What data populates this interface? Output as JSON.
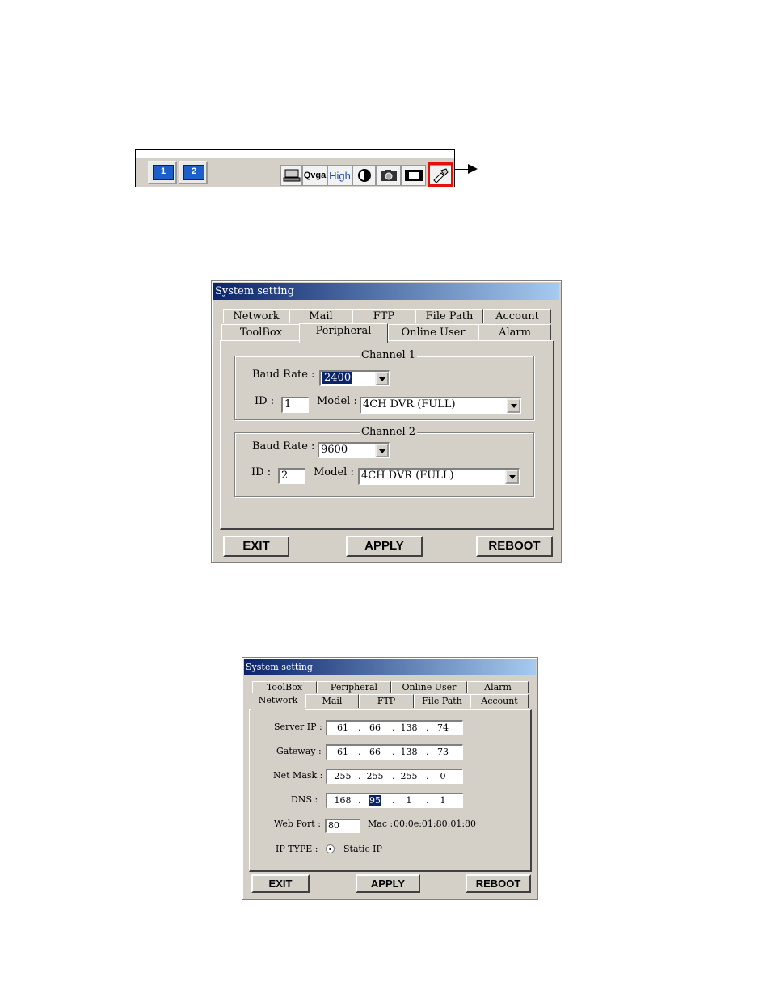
{
  "toolbar": {
    "channel_buttons": [
      "1",
      "2"
    ],
    "icons": [
      {
        "name": "network-drive-icon",
        "label": ""
      },
      {
        "name": "qvga-icon",
        "label": "Qvga"
      },
      {
        "name": "high-quality-icon",
        "label": "High"
      },
      {
        "name": "contrast-icon",
        "label": ""
      },
      {
        "name": "camera-snapshot-icon",
        "label": ""
      },
      {
        "name": "film-record-icon",
        "label": ""
      },
      {
        "name": "settings-tools-icon",
        "label": ""
      }
    ],
    "highlight_color": "#e31010"
  },
  "dialog1": {
    "title": "System setting",
    "tabs_row1": [
      "Network",
      "Mail",
      "FTP",
      "File Path",
      "Account"
    ],
    "tabs_row2": [
      "ToolBox",
      "Peripheral",
      "Online User",
      "Alarm"
    ],
    "active_tab": "Peripheral",
    "channel1": {
      "title": "Channel 1",
      "baud_label": "Baud Rate :",
      "baud_value": "2400",
      "id_label": "ID :",
      "id_value": "1",
      "model_label": "Model :",
      "model_value": "4CH DVR (FULL)"
    },
    "channel2": {
      "title": "Channel 2",
      "baud_label": "Baud Rate :",
      "baud_value": "9600",
      "id_label": "ID :",
      "id_value": "2",
      "model_label": "Model :",
      "model_value": "4CH DVR (FULL)"
    },
    "buttons": {
      "exit": "EXIT",
      "apply": "APPLY",
      "reboot": "REBOOT"
    }
  },
  "dialog2": {
    "title": "System setting",
    "tabs_row1": [
      "ToolBox",
      "Peripheral",
      "Online User",
      "Alarm"
    ],
    "tabs_row2": [
      "Network",
      "Mail",
      "FTP",
      "File Path",
      "Account"
    ],
    "active_tab": "Network",
    "server_ip": {
      "label": "Server IP :",
      "octets": [
        "61",
        "66",
        "138",
        "74"
      ]
    },
    "gateway": {
      "label": "Gateway :",
      "octets": [
        "61",
        "66",
        "138",
        "73"
      ]
    },
    "net_mask": {
      "label": "Net Mask :",
      "octets": [
        "255",
        "255",
        "255",
        "0"
      ]
    },
    "dns": {
      "label": "DNS :",
      "octets": [
        "168",
        "95",
        "1",
        "1"
      ]
    },
    "web_port": {
      "label": "Web Port :",
      "value": "80"
    },
    "mac": {
      "label": "Mac :",
      "value": "00:0e:01:80:01:80"
    },
    "ip_type": {
      "label": "IP TYPE :",
      "value": "Static IP"
    },
    "buttons": {
      "exit": "EXIT",
      "apply": "APPLY",
      "reboot": "REBOOT"
    }
  }
}
